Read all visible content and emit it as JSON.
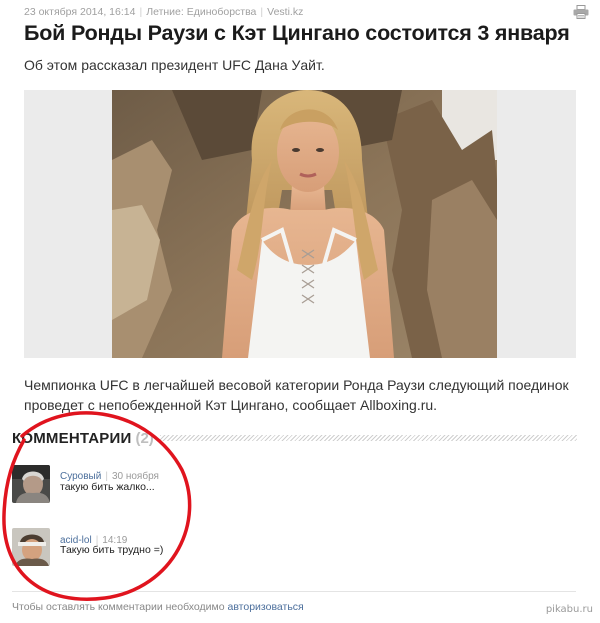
{
  "meta": {
    "date": "23 октября 2014, 16:14",
    "section": "Летние: Единоборства",
    "source": "Vesti.kz"
  },
  "article": {
    "title": "Бой Ронды Раузи с Кэт Цингано состоится 3 января",
    "lead": "Об этом рассказал президент UFC Дана Уайт.",
    "body": "Чемпионка UFC в легчайшей весовой категории Ронда Раузи следующий поединок проведет с непобежденной Кэт Цингано, сообщает Allboxing.ru."
  },
  "comments": {
    "title": "КОММЕНТАРИИ",
    "count": "(2)",
    "items": [
      {
        "author": "Суровый",
        "date": "30 ноября",
        "text": "такую бить жалко..."
      },
      {
        "author": "acid-lol",
        "date": "14:19",
        "text": "Такую бить трудно =)"
      }
    ],
    "login_prefix": "Чтобы оставлять комментарии необходимо ",
    "login_link": "авторизоваться"
  },
  "watermark": "pikabu.ru",
  "icons": {
    "print": "printer-icon"
  },
  "colors": {
    "link": "#4c6f9c",
    "annotation": "#e0141e",
    "meta": "#a0a0a0"
  }
}
